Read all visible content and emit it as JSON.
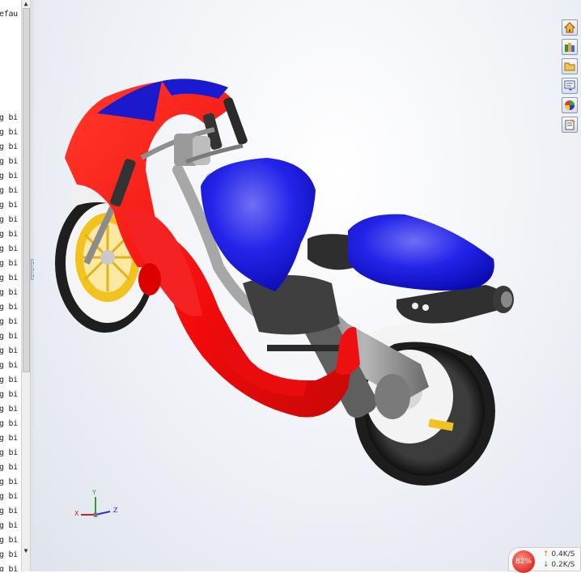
{
  "feature_tree": {
    "top_text": "efau",
    "row_text": "g bi",
    "row_count": 32
  },
  "taskpane": {
    "buttons": [
      "home-icon",
      "library-icon",
      "folder-icon",
      "view-palette-icon",
      "appearance-icon",
      "custom-properties-icon"
    ]
  },
  "triad": {
    "x": "X",
    "y": "Y",
    "z": "Z"
  },
  "network_monitor": {
    "percent": "82%",
    "upload": "0.4K/S",
    "download": "0.2K/S"
  },
  "colors": {
    "fairing_red": "#f40f0f",
    "seat_blue": "#1515e6",
    "rim_yellow": "#f2c21e",
    "frame_gray": "#9b9b9b",
    "tire_black": "#2a2a2a"
  }
}
